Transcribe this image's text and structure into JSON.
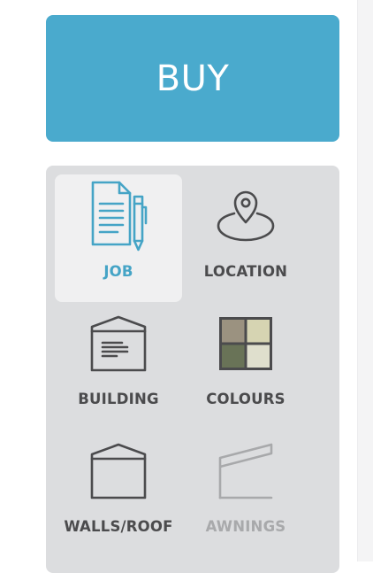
{
  "buy_button": {
    "label": "BUY"
  },
  "nav": {
    "items": [
      {
        "label": "JOB",
        "icon": "document-pencil-icon",
        "state": "active"
      },
      {
        "label": "LOCATION",
        "icon": "location-pin-icon",
        "state": "normal"
      },
      {
        "label": "BUILDING",
        "icon": "building-icon",
        "state": "normal"
      },
      {
        "label": "COLOURS",
        "icon": "colour-swatch-icon",
        "state": "normal"
      },
      {
        "label": "WALLS/ROOF",
        "icon": "walls-roof-icon",
        "state": "normal"
      },
      {
        "label": "AWNINGS",
        "icon": "awning-icon",
        "state": "disabled"
      }
    ]
  },
  "colors": {
    "accent": "#4aaacd",
    "active_label": "#45a4c6",
    "panel_bg": "#dcdddf",
    "active_tile_bg": "#f0f0f1",
    "label": "#4b4b4d",
    "disabled_label": "#a8a9ab",
    "swatches": [
      "#9b9280",
      "#d6d4b2",
      "#697357",
      "#dfdfcd"
    ]
  }
}
